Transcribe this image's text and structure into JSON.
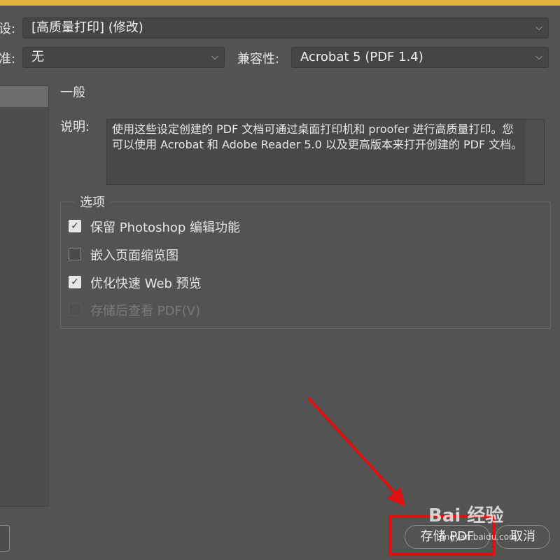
{
  "dialog": {
    "preset_label_fragment": "设:",
    "preset_value": "[高质量打印] (修改)",
    "standard_label_fragment": "准:",
    "standard_value": "无",
    "compat_label": "兼容性:",
    "compat_value": "Acrobat 5 (PDF 1.4)"
  },
  "general": {
    "section_title": "一般",
    "description_label": "说明:",
    "description_text": "使用这些设定创建的 PDF 文档可通过桌面打印机和 proofer 进行高质量打印。您可以使用 Acrobat 和 Adobe Reader 5.0 以及更高版本来打开创建的 PDF 文档。"
  },
  "options": {
    "legend": "选项",
    "items": [
      {
        "label": "保留 Photoshop 编辑功能",
        "checked": true,
        "enabled": true
      },
      {
        "label": "嵌入页面缩览图",
        "checked": false,
        "enabled": true
      },
      {
        "label": "优化快速 Web 预览",
        "checked": true,
        "enabled": true
      },
      {
        "label": "存储后查看 PDF(V)",
        "checked": false,
        "enabled": false
      }
    ]
  },
  "buttons": {
    "save_pdf": "存储 PDF",
    "cancel": "取消"
  },
  "watermark": {
    "logo": "Bai 经验",
    "url": "jingyan.baidu.com"
  },
  "colors": {
    "accent": "#e0b43a",
    "background": "#535353",
    "highlight": "#e01010"
  }
}
